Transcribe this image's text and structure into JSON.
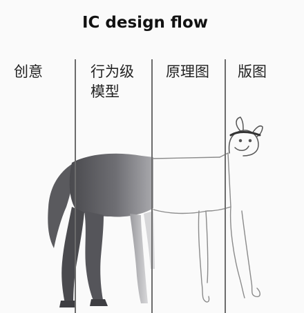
{
  "title": "IC design flow",
  "stages": [
    {
      "label": "创意"
    },
    {
      "label": "行为级模型"
    },
    {
      "label": "原理图"
    },
    {
      "label": "版图"
    }
  ]
}
